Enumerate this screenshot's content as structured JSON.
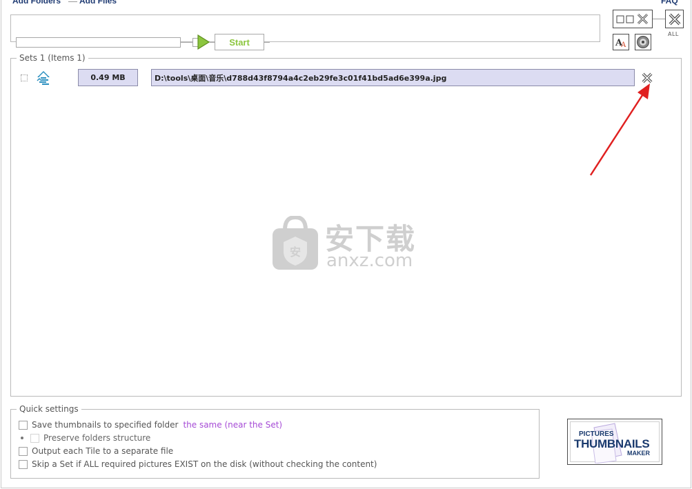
{
  "header": {
    "add_folders_label": "Add Folders",
    "add_files_label": "Add Files",
    "faq_label": "FAQ"
  },
  "run": {
    "start_label": "Start",
    "progress": 0
  },
  "toolbar": {
    "all_label": "ALL",
    "icons": [
      "layout-toggle-icon",
      "close-all-icon",
      "font-settings-icon",
      "disc-icon"
    ]
  },
  "sets": {
    "legend": "Sets 1 (Items 1)",
    "items": [
      {
        "size": "0.49 MB",
        "path": "D:\\tools\\桌面\\音乐\\d788d43f8794a4c2eb29fe3c01f41bd5ad6e399a.jpg",
        "icon": "folder-tree-icon"
      }
    ]
  },
  "watermark": {
    "cn": "安下载",
    "en": "anxz.com"
  },
  "quick_settings": {
    "legend": "Quick settings",
    "save_to_folder_label": "Save thumbnails to specified folder",
    "save_to_folder_link": "the same (near the Set)",
    "preserve_structure_label": "Preserve folders structure",
    "output_tile_label": "Output each Tile to a separate file",
    "skip_set_label": "Skip a Set if ALL required pictures EXIST on the disk (without checking the content)"
  },
  "logo": {
    "line1": "PICTURES",
    "line2": "THUMBNAILS",
    "line3": "MAKER"
  },
  "colors": {
    "accent_green": "#8cc63f",
    "field_bg": "#dcdcf2",
    "link_purple": "#a64bd6",
    "annotation_red": "#e02020"
  }
}
